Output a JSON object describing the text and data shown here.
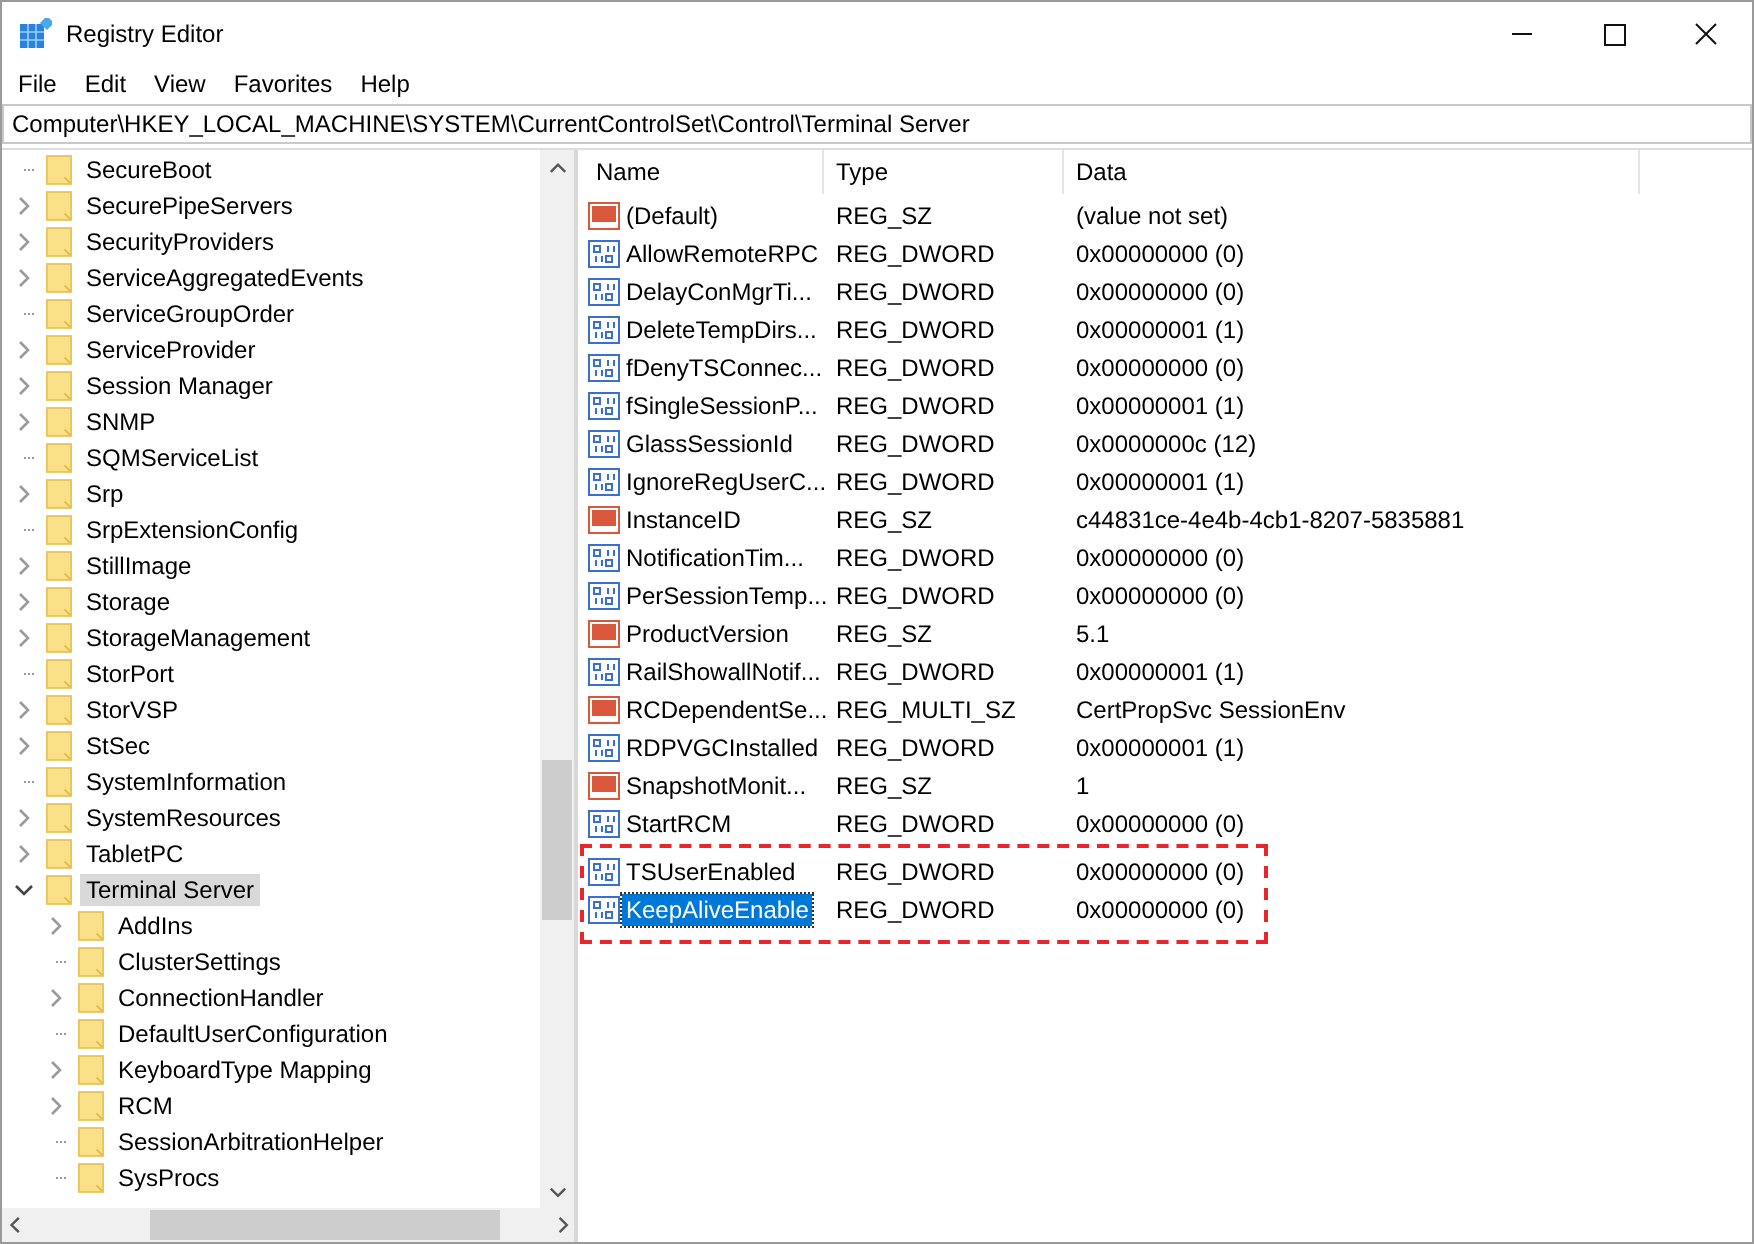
{
  "window": {
    "title": "Registry Editor"
  },
  "menu": [
    "File",
    "Edit",
    "View",
    "Favorites",
    "Help"
  ],
  "address": "Computer\\HKEY_LOCAL_MACHINE\\SYSTEM\\CurrentControlSet\\Control\\Terminal Server",
  "tree": [
    {
      "label": "SecureBoot",
      "kind": "leaf",
      "selected": false
    },
    {
      "label": "SecurePipeServers",
      "kind": "collapsed",
      "selected": false
    },
    {
      "label": "SecurityProviders",
      "kind": "collapsed",
      "selected": false
    },
    {
      "label": "ServiceAggregatedEvents",
      "kind": "collapsed",
      "selected": false
    },
    {
      "label": "ServiceGroupOrder",
      "kind": "leaf",
      "selected": false
    },
    {
      "label": "ServiceProvider",
      "kind": "collapsed",
      "selected": false
    },
    {
      "label": "Session Manager",
      "kind": "collapsed",
      "selected": false
    },
    {
      "label": "SNMP",
      "kind": "collapsed",
      "selected": false
    },
    {
      "label": "SQMServiceList",
      "kind": "leaf",
      "selected": false
    },
    {
      "label": "Srp",
      "kind": "collapsed",
      "selected": false
    },
    {
      "label": "SrpExtensionConfig",
      "kind": "leaf",
      "selected": false
    },
    {
      "label": "StillImage",
      "kind": "collapsed",
      "selected": false
    },
    {
      "label": "Storage",
      "kind": "collapsed",
      "selected": false
    },
    {
      "label": "StorageManagement",
      "kind": "collapsed",
      "selected": false
    },
    {
      "label": "StorPort",
      "kind": "leaf",
      "selected": false
    },
    {
      "label": "StorVSP",
      "kind": "collapsed",
      "selected": false
    },
    {
      "label": "StSec",
      "kind": "collapsed",
      "selected": false
    },
    {
      "label": "SystemInformation",
      "kind": "leaf",
      "selected": false
    },
    {
      "label": "SystemResources",
      "kind": "collapsed",
      "selected": false
    },
    {
      "label": "TabletPC",
      "kind": "collapsed",
      "selected": false
    },
    {
      "label": "Terminal Server",
      "kind": "expanded",
      "selected": true,
      "children": [
        {
          "label": "AddIns",
          "kind": "collapsed",
          "selected": false
        },
        {
          "label": "ClusterSettings",
          "kind": "leaf",
          "selected": false
        },
        {
          "label": "ConnectionHandler",
          "kind": "collapsed",
          "selected": false
        },
        {
          "label": "DefaultUserConfiguration",
          "kind": "leaf",
          "selected": false
        },
        {
          "label": "KeyboardType Mapping",
          "kind": "collapsed",
          "selected": false
        },
        {
          "label": "RCM",
          "kind": "collapsed",
          "selected": false
        },
        {
          "label": "SessionArbitrationHelper",
          "kind": "leaf",
          "selected": false
        },
        {
          "label": "SysProcs",
          "kind": "leaf",
          "selected": false
        }
      ]
    }
  ],
  "columns": [
    "Name",
    "Type",
    "Data"
  ],
  "rows": [
    {
      "kind": "string",
      "name": "(Default)",
      "type": "REG_SZ",
      "data": "(value not set)",
      "selected": false
    },
    {
      "kind": "binary",
      "name": "AllowRemoteRPC",
      "type": "REG_DWORD",
      "data": "0x00000000 (0)",
      "selected": false
    },
    {
      "kind": "binary",
      "name": "DelayConMgrTi...",
      "type": "REG_DWORD",
      "data": "0x00000000 (0)",
      "selected": false
    },
    {
      "kind": "binary",
      "name": "DeleteTempDirs...",
      "type": "REG_DWORD",
      "data": "0x00000001 (1)",
      "selected": false
    },
    {
      "kind": "binary",
      "name": "fDenyTSConnec...",
      "type": "REG_DWORD",
      "data": "0x00000000 (0)",
      "selected": false
    },
    {
      "kind": "binary",
      "name": "fSingleSessionP...",
      "type": "REG_DWORD",
      "data": "0x00000001 (1)",
      "selected": false
    },
    {
      "kind": "binary",
      "name": "GlassSessionId",
      "type": "REG_DWORD",
      "data": "0x0000000c (12)",
      "selected": false
    },
    {
      "kind": "binary",
      "name": "IgnoreRegUserC...",
      "type": "REG_DWORD",
      "data": "0x00000001 (1)",
      "selected": false
    },
    {
      "kind": "string",
      "name": "InstanceID",
      "type": "REG_SZ",
      "data": "c44831ce-4e4b-4cb1-8207-5835881",
      "selected": false
    },
    {
      "kind": "binary",
      "name": "NotificationTim...",
      "type": "REG_DWORD",
      "data": "0x00000000 (0)",
      "selected": false
    },
    {
      "kind": "binary",
      "name": "PerSessionTemp...",
      "type": "REG_DWORD",
      "data": "0x00000000 (0)",
      "selected": false
    },
    {
      "kind": "string",
      "name": "ProductVersion",
      "type": "REG_SZ",
      "data": "5.1",
      "selected": false
    },
    {
      "kind": "binary",
      "name": "RailShowallNotif...",
      "type": "REG_DWORD",
      "data": "0x00000001 (1)",
      "selected": false
    },
    {
      "kind": "string",
      "name": "RCDependentSe...",
      "type": "REG_MULTI_SZ",
      "data": "CertPropSvc SessionEnv",
      "selected": false
    },
    {
      "kind": "binary",
      "name": "RDPVGCInstalled",
      "type": "REG_DWORD",
      "data": "0x00000001 (1)",
      "selected": false
    },
    {
      "kind": "string",
      "name": "SnapshotMonit...",
      "type": "REG_SZ",
      "data": "1",
      "selected": false
    },
    {
      "kind": "binary",
      "name": "StartRCM",
      "type": "REG_DWORD",
      "data": "0x00000000 (0)",
      "selected": false
    }
  ],
  "highlighted_rows": [
    {
      "kind": "binary",
      "name": "TSUserEnabled",
      "type": "REG_DWORD",
      "data": "0x00000000 (0)",
      "selected": false
    },
    {
      "kind": "binary",
      "name": "KeepAliveEnable",
      "type": "REG_DWORD",
      "data": "0x00000000 (0)",
      "selected": true
    }
  ]
}
